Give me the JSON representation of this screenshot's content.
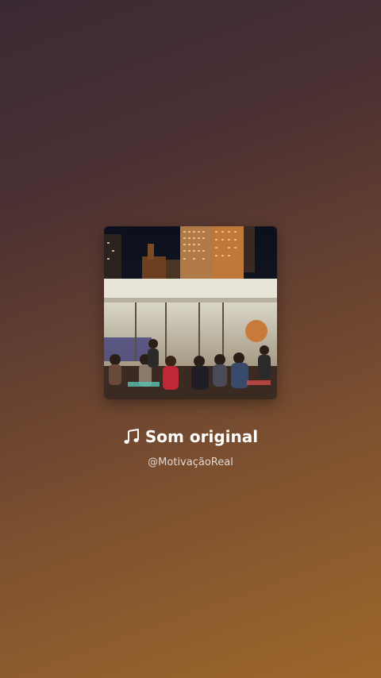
{
  "sound": {
    "title": "Som original",
    "author": "@MotivaçãoReal",
    "icon": "music-note-icon"
  },
  "cover": {
    "description_icon": "album-cover-image"
  },
  "colors": {
    "text_primary": "#ffffff",
    "text_secondary": "#e8d9cc"
  }
}
